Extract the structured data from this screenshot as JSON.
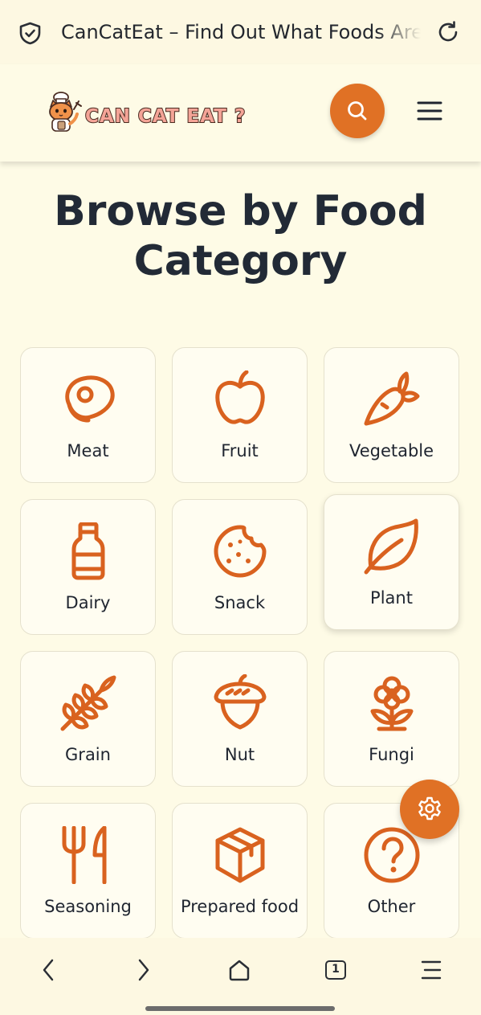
{
  "browser": {
    "tab_title": "CanCatEat – Find Out What Foods Are Safe for Your Cat",
    "tab_count": "1"
  },
  "header": {
    "logo_text": "CAN CAT EAT ?"
  },
  "main": {
    "heading_line1": "Browse by Food",
    "heading_line2": "Category",
    "categories": [
      {
        "label": "Meat",
        "icon": "meat-icon"
      },
      {
        "label": "Fruit",
        "icon": "apple-icon"
      },
      {
        "label": "Vegetable",
        "icon": "carrot-icon"
      },
      {
        "label": "Dairy",
        "icon": "milk-bottle-icon"
      },
      {
        "label": "Snack",
        "icon": "cookie-icon"
      },
      {
        "label": "Plant",
        "icon": "leaf-icon"
      },
      {
        "label": "Grain",
        "icon": "wheat-icon"
      },
      {
        "label": "Nut",
        "icon": "acorn-icon"
      },
      {
        "label": "Fungi",
        "icon": "flower-icon"
      },
      {
        "label": "Seasoning",
        "icon": "utensils-icon"
      },
      {
        "label": "Prepared food",
        "icon": "box-icon"
      },
      {
        "label": "Other",
        "icon": "question-circle-icon"
      }
    ]
  },
  "colors": {
    "accent": "#e07125",
    "icon": "#d9621f",
    "background": "#fefbe6",
    "heading": "#222a36"
  }
}
